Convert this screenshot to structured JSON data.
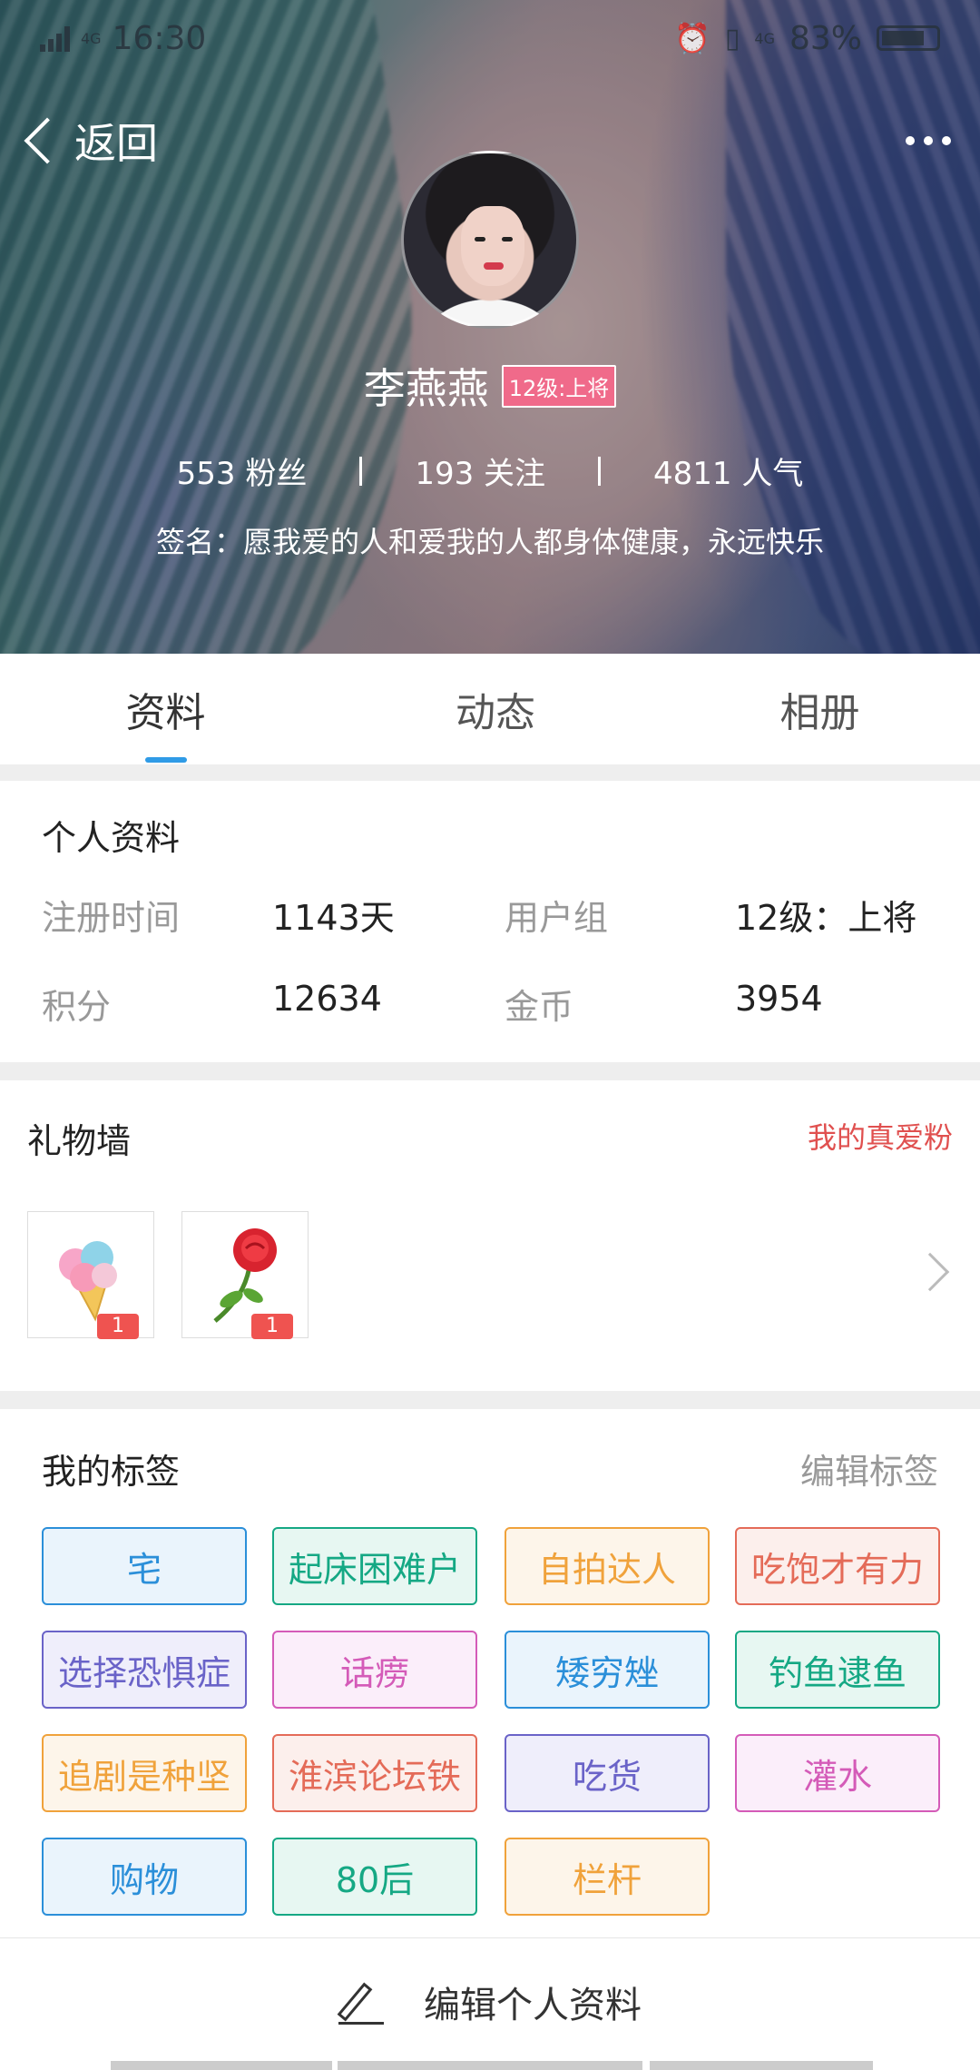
{
  "status_bar": {
    "network_left": "4G",
    "time": "16:30",
    "network_right": "4G",
    "battery": "83%"
  },
  "nav": {
    "back_label": "返回"
  },
  "profile_header": {
    "name": "李燕燕",
    "level_badge": "12级:上将",
    "fans": "553 粉丝",
    "following": "193 关注",
    "popularity": "4811 人气",
    "signature": "签名：愿我爱的人和爱我的人都身体健康，永远快乐"
  },
  "tabs": [
    {
      "label": "资料",
      "active": true
    },
    {
      "label": "动态",
      "active": false
    },
    {
      "label": "相册",
      "active": false
    }
  ],
  "personal_info": {
    "title": "个人资料",
    "register_label": "注册时间",
    "register_value": "1143天",
    "group_label": "用户组",
    "group_value": "12级：上将",
    "points_label": "积分",
    "points_value": "12634",
    "coins_label": "金币",
    "coins_value": "3954"
  },
  "gift_wall": {
    "title": "礼物墙",
    "fans_link": "我的真爱粉",
    "gifts": [
      {
        "icon": "ice-cream-icon",
        "count": "1"
      },
      {
        "icon": "rose-icon",
        "count": "1"
      }
    ]
  },
  "tags_section": {
    "title": "我的标签",
    "edit_label": "编辑标签",
    "tags": [
      {
        "label": "宅",
        "color": "#2b8fd9",
        "bg": "#eaf4fc"
      },
      {
        "label": "起床困难户",
        "color": "#15a884",
        "bg": "#e7f7f2"
      },
      {
        "label": "自拍达人",
        "color": "#f0a23b",
        "bg": "#fdf5ea"
      },
      {
        "label": "吃饱才有力",
        "color": "#e46b58",
        "bg": "#fcefec"
      },
      {
        "label": "选择恐惧症",
        "color": "#6a63c8",
        "bg": "#efeefb"
      },
      {
        "label": "话痨",
        "color": "#d45bb8",
        "bg": "#fbeefa"
      },
      {
        "label": "矮穷矬",
        "color": "#2b8fd9",
        "bg": "#eaf4fc"
      },
      {
        "label": "钓鱼逮鱼",
        "color": "#15a884",
        "bg": "#e7f7f2"
      },
      {
        "label": "追剧是种坚",
        "color": "#f0a23b",
        "bg": "#fdf5ea"
      },
      {
        "label": "淮滨论坛铁",
        "color": "#e46b58",
        "bg": "#fcefec"
      },
      {
        "label": "吃货",
        "color": "#6a63c8",
        "bg": "#efeefb"
      },
      {
        "label": "灌水",
        "color": "#d45bb8",
        "bg": "#fbeefa"
      },
      {
        "label": "购物",
        "color": "#2b8fd9",
        "bg": "#eaf4fc"
      },
      {
        "label": "80后",
        "color": "#15a884",
        "bg": "#e7f7f2"
      },
      {
        "label": "栏杆",
        "color": "#f0a23b",
        "bg": "#fdf5ea"
      }
    ]
  },
  "bottom": {
    "edit_profile_label": "编辑个人资料"
  }
}
